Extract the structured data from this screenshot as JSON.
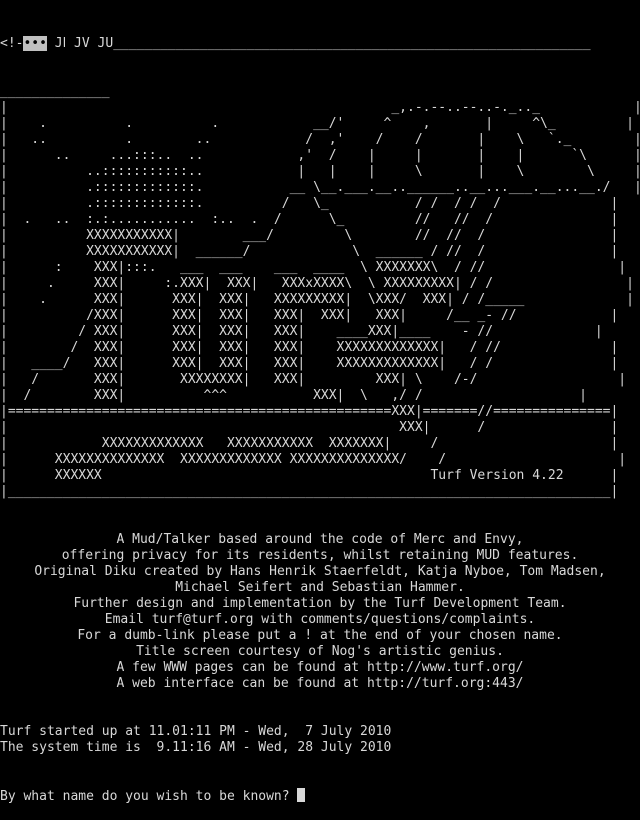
{
  "top_line": {
    "prefix": "<!-",
    "highlighted": "•••",
    "suffix": " Jⅼ JV JU"
  },
  "banner_art": [
    "______________                                                                  ",
    "|                                                 _,.-.--..--..-._.._            |",
    "|    .          .          .            __/'     ^    ,       |     ^\\_         |",
    "|   ..          .        ..            /  ,'    /    /       |    \\   `._        |",
    "|      ..     ...:::..  ..            ,'  /    |     |       |    |      `\\      |",
    "|          ..:::::::::::..            |   |    |     \\       |    \\        \\     |",
    "|          .:::::::::::::.           __ \\__.___.__..______..__...___.__...__./   |",
    "|          .:::::::::::::.          /   \\_           / /  / /  /              |",
    "|  .   ..  :.:...........  :..  .  /      \\_         //   //  /               |",
    "|          XXXXXXXXXXX|        ___/         \\        //  //  /                |",
    "|          XXXXXXXXXXX|  ______/             \\  ______ / //  /                |",
    "|      :    XXX|:::.   ___  ___    ___  ____  \\ XXXXXXX\\  / //                 |",
    "|     .     XXX|     :.XXX|  XXX|   XXXxXXXX\\  \\ XXXXXXXXX| / /                 |",
    "|    .      XXX|      XXX|  XXX|   XXXXXXXXX|  \\XXX/  XXX| / /_____             |",
    "|          /XXX|      XXX|  XXX|   XXX|  XXX|   XXX|     /__ _- //            |",
    "|         / XXX|      XXX|  XXX|   XXX|    ____XXX|____    - //             |",
    "|        /  XXX|      XXX|  XXX|   XXX|    XXXXXXXXXXXXX|   / //              |",
    "|   ____/   XXX|      XXX|  XXX|   XXX|    XXXXXXXXXXXXX|   / /               |",
    "|   /       XXX|       XXXXXXXX|   XXX|         XXX| \\    /-/                  |",
    "|  /        XXX|          ^^^           XXX|  \\   ,/ /                    |",
    "|=================================================XXX|=======//===============|",
    "|                                                  XXX|      /                |",
    "|            XXXXXXXXXXXXX   XXXXXXXXXXX  XXXXXXX|     /                      |",
    "|      XXXXXXXXXXXXXX  XXXXXXXXXXXXX XXXXXXXXXXXXXX/    /                      |",
    "|      XXXXXX                                          Turf Version 4.22      |",
    "|_____________________________________________________________________________|"
  ],
  "info_lines": [
    "A Mud/Talker based around the code of Merc and Envy,",
    "offering privacy for its residents, whilst retaining MUD features.",
    "Original Diku created by Hans Henrik Staerfeldt, Katja Nyboe, Tom Madsen,",
    "Michael Seifert and Sebastian Hammer.",
    "Further design and implementation by the Turf Development Team.",
    "Email turf@turf.org with comments/questions/complaints.",
    "For a dumb-link please put a ! at the end of your chosen name.",
    "Title screen courtesy of Nog's artistic genius.",
    "A few WWW pages can be found at http://www.turf.org/",
    "A web interface can be found at http://turf.org:443/"
  ],
  "status_lines": [
    "Turf started up at 11.01:11 PM - Wed,  7 July 2010",
    "The system time is  9.11:16 AM - Wed, 28 July 2010"
  ],
  "prompt": "By what name do you wish to be known?"
}
